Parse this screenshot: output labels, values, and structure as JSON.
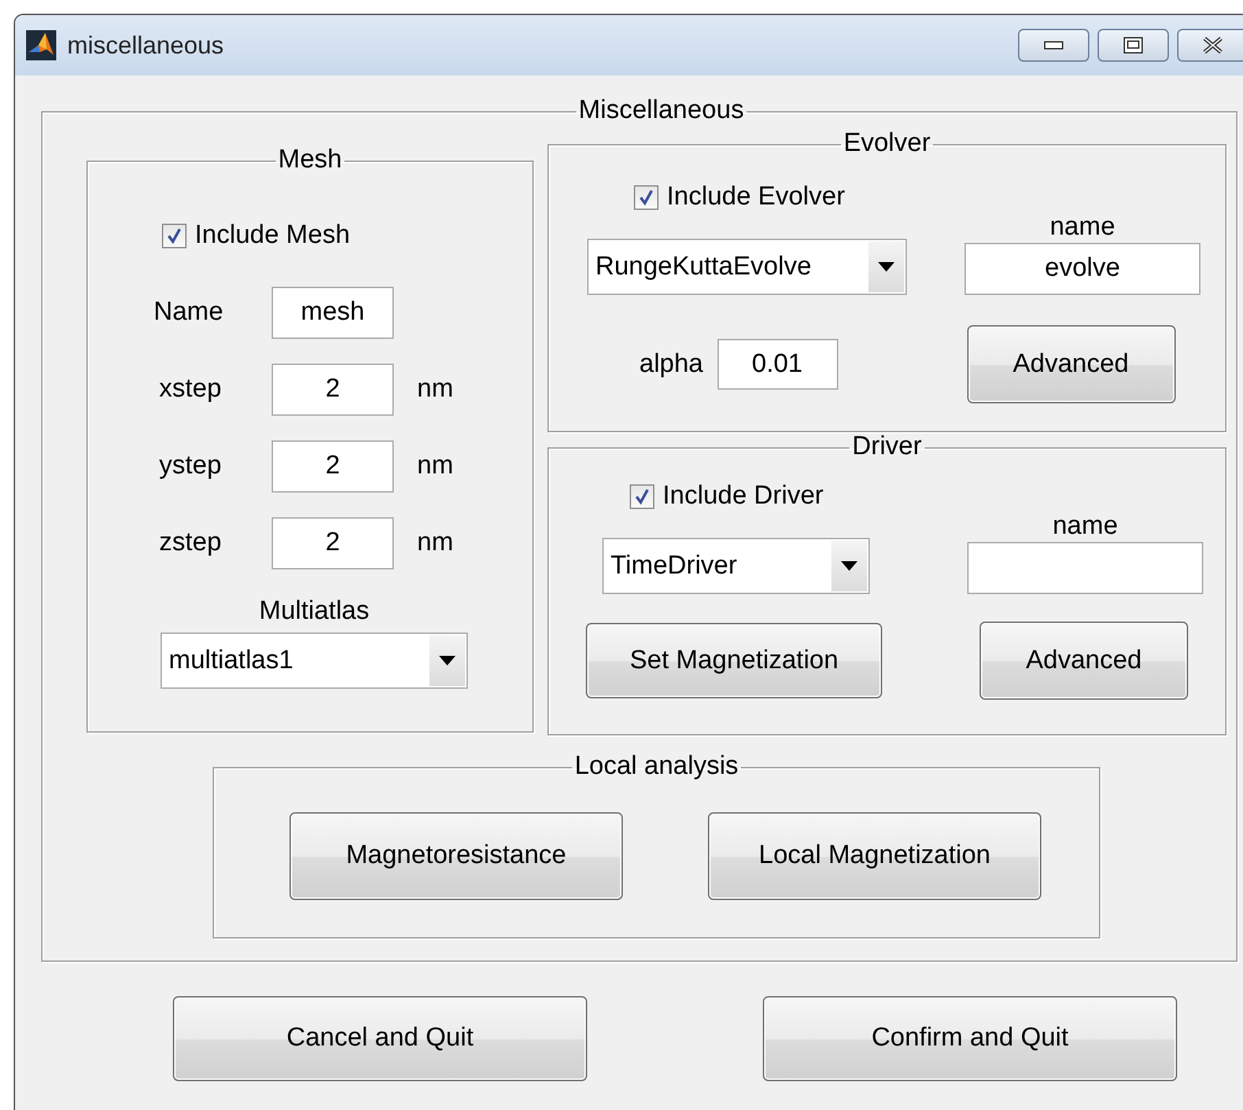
{
  "window": {
    "title": "miscellaneous"
  },
  "main_panel": {
    "title": "Miscellaneous"
  },
  "mesh": {
    "title": "Mesh",
    "include": {
      "label": "Include Mesh",
      "checked": true
    },
    "name": {
      "label": "Name",
      "value": "mesh"
    },
    "steps": [
      {
        "label": "xstep",
        "value": "2",
        "unit": "nm"
      },
      {
        "label": "ystep",
        "value": "2",
        "unit": "nm"
      },
      {
        "label": "zstep",
        "value": "2",
        "unit": "nm"
      }
    ],
    "multiatlas": {
      "label": "Multiatlas",
      "value": "multiatlas1"
    }
  },
  "evolver": {
    "title": "Evolver",
    "include": {
      "label": "Include Evolver",
      "checked": true
    },
    "type": {
      "value": "RungeKuttaEvolve"
    },
    "name": {
      "label": "name",
      "value": "evolve"
    },
    "alpha": {
      "label": "alpha",
      "value": "0.01"
    },
    "advanced_button": "Advanced"
  },
  "driver": {
    "title": "Driver",
    "include": {
      "label": "Include Driver",
      "checked": true
    },
    "type": {
      "value": "TimeDriver"
    },
    "name": {
      "label": "name"
    },
    "magnetization_button": "Set Magnetization",
    "advanced_button": "Advanced"
  },
  "local_analysis": {
    "title": "Local analysis",
    "buttons": [
      "Magnetoresistance",
      "Local Magnetization"
    ]
  },
  "buttons": [
    "Cancel and Quit",
    "Confirm and Quit"
  ]
}
